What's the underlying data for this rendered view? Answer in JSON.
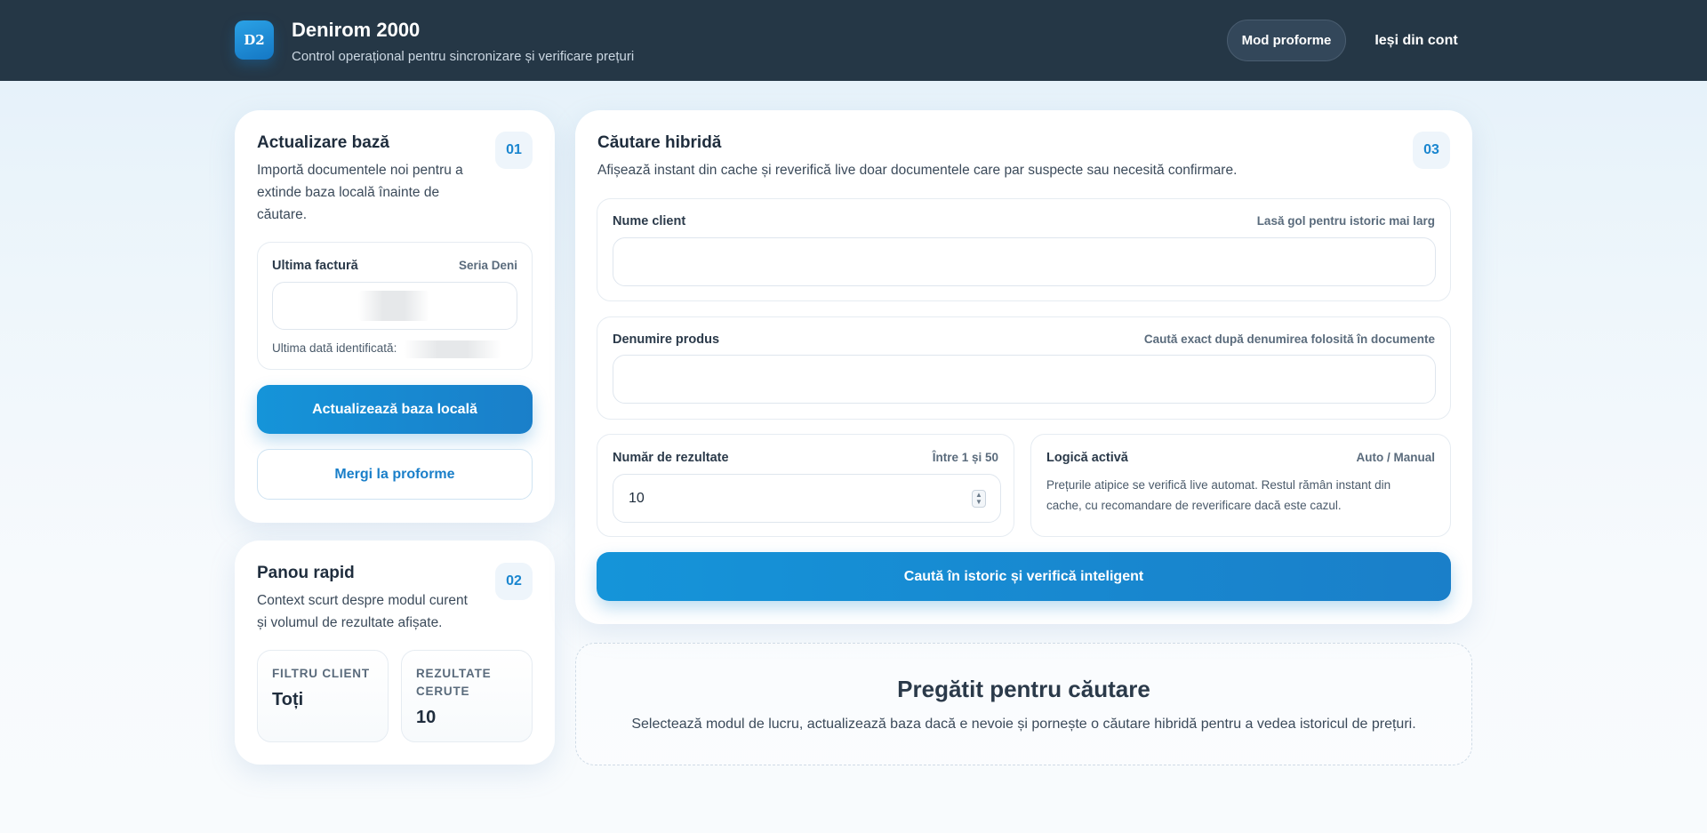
{
  "header": {
    "logo_text": "D2",
    "title": "Denirom 2000",
    "subtitle": "Control operațional pentru sincronizare și verificare prețuri",
    "proforme_mode_label": "Mod proforme",
    "logout_label": "Ieși din cont"
  },
  "update_card": {
    "title": "Actualizare bază",
    "step": "01",
    "description_lines": [
      "Importă documentele noi pentru a",
      "extinde baza locală înainte de",
      "căutare."
    ],
    "last_invoice_label": "Ultima factură",
    "series_label": "Seria Deni",
    "last_date_label": "Ultima dată identificată:",
    "update_button": "Actualizează baza locală",
    "proforme_button": "Mergi la proforme"
  },
  "quick_panel": {
    "title": "Panou rapid",
    "step": "02",
    "description_lines": [
      "Context scurt despre modul curent",
      "și volumul de rezultate afișate."
    ],
    "client_filter_label": "FILTRU CLIENT",
    "client_filter_value": "Toți",
    "results_label_lines": [
      "REZULTATE",
      "CERUTE"
    ],
    "results_value": "10"
  },
  "search_card": {
    "title": "Căutare hibridă",
    "step": "03",
    "description": "Afișează instant din cache și reverifică live doar documentele care par suspecte sau necesită confirmare.",
    "client_name_label": "Nume client",
    "client_name_hint": "Lasă gol pentru istoric mai larg",
    "client_name_value": "",
    "product_label": "Denumire produs",
    "product_hint": "Caută exact după denumirea folosită în documente",
    "product_value": "",
    "results_count_label": "Număr de rezultate",
    "results_count_hint": "Între 1 și 50",
    "results_count_value": "10",
    "logic_label": "Logică activă",
    "logic_hint": "Auto / Manual",
    "logic_text_lines": [
      "Prețurile atipice se verifică live automat. Restul rămân instant din",
      "cache, cu recomandare de reverificare dacă este cazul."
    ],
    "search_button": "Caută în istoric și verifică inteligent"
  },
  "empty_state": {
    "title": "Pregătit pentru căutare",
    "text": "Selectează modul de lucru, actualizează baza dacă e nevoie și pornește o căutare hibridă pentru a vedea istoricul de prețuri."
  },
  "colors": {
    "header_bg": "#253746",
    "accent": "#1a86cf"
  }
}
